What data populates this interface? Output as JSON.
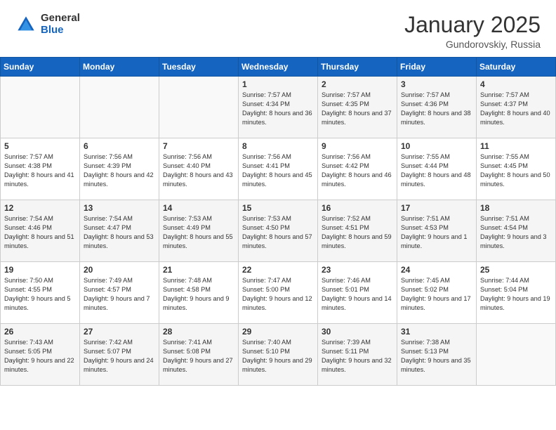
{
  "header": {
    "logo_general": "General",
    "logo_blue": "Blue",
    "month_title": "January 2025",
    "location": "Gundorovskiy, Russia"
  },
  "days_of_week": [
    "Sunday",
    "Monday",
    "Tuesday",
    "Wednesday",
    "Thursday",
    "Friday",
    "Saturday"
  ],
  "weeks": [
    [
      {
        "day": "",
        "info": ""
      },
      {
        "day": "",
        "info": ""
      },
      {
        "day": "",
        "info": ""
      },
      {
        "day": "1",
        "info": "Sunrise: 7:57 AM\nSunset: 4:34 PM\nDaylight: 8 hours and 36 minutes."
      },
      {
        "day": "2",
        "info": "Sunrise: 7:57 AM\nSunset: 4:35 PM\nDaylight: 8 hours and 37 minutes."
      },
      {
        "day": "3",
        "info": "Sunrise: 7:57 AM\nSunset: 4:36 PM\nDaylight: 8 hours and 38 minutes."
      },
      {
        "day": "4",
        "info": "Sunrise: 7:57 AM\nSunset: 4:37 PM\nDaylight: 8 hours and 40 minutes."
      }
    ],
    [
      {
        "day": "5",
        "info": "Sunrise: 7:57 AM\nSunset: 4:38 PM\nDaylight: 8 hours and 41 minutes."
      },
      {
        "day": "6",
        "info": "Sunrise: 7:56 AM\nSunset: 4:39 PM\nDaylight: 8 hours and 42 minutes."
      },
      {
        "day": "7",
        "info": "Sunrise: 7:56 AM\nSunset: 4:40 PM\nDaylight: 8 hours and 43 minutes."
      },
      {
        "day": "8",
        "info": "Sunrise: 7:56 AM\nSunset: 4:41 PM\nDaylight: 8 hours and 45 minutes."
      },
      {
        "day": "9",
        "info": "Sunrise: 7:56 AM\nSunset: 4:42 PM\nDaylight: 8 hours and 46 minutes."
      },
      {
        "day": "10",
        "info": "Sunrise: 7:55 AM\nSunset: 4:44 PM\nDaylight: 8 hours and 48 minutes."
      },
      {
        "day": "11",
        "info": "Sunrise: 7:55 AM\nSunset: 4:45 PM\nDaylight: 8 hours and 50 minutes."
      }
    ],
    [
      {
        "day": "12",
        "info": "Sunrise: 7:54 AM\nSunset: 4:46 PM\nDaylight: 8 hours and 51 minutes."
      },
      {
        "day": "13",
        "info": "Sunrise: 7:54 AM\nSunset: 4:47 PM\nDaylight: 8 hours and 53 minutes."
      },
      {
        "day": "14",
        "info": "Sunrise: 7:53 AM\nSunset: 4:49 PM\nDaylight: 8 hours and 55 minutes."
      },
      {
        "day": "15",
        "info": "Sunrise: 7:53 AM\nSunset: 4:50 PM\nDaylight: 8 hours and 57 minutes."
      },
      {
        "day": "16",
        "info": "Sunrise: 7:52 AM\nSunset: 4:51 PM\nDaylight: 8 hours and 59 minutes."
      },
      {
        "day": "17",
        "info": "Sunrise: 7:51 AM\nSunset: 4:53 PM\nDaylight: 9 hours and 1 minute."
      },
      {
        "day": "18",
        "info": "Sunrise: 7:51 AM\nSunset: 4:54 PM\nDaylight: 9 hours and 3 minutes."
      }
    ],
    [
      {
        "day": "19",
        "info": "Sunrise: 7:50 AM\nSunset: 4:55 PM\nDaylight: 9 hours and 5 minutes."
      },
      {
        "day": "20",
        "info": "Sunrise: 7:49 AM\nSunset: 4:57 PM\nDaylight: 9 hours and 7 minutes."
      },
      {
        "day": "21",
        "info": "Sunrise: 7:48 AM\nSunset: 4:58 PM\nDaylight: 9 hours and 9 minutes."
      },
      {
        "day": "22",
        "info": "Sunrise: 7:47 AM\nSunset: 5:00 PM\nDaylight: 9 hours and 12 minutes."
      },
      {
        "day": "23",
        "info": "Sunrise: 7:46 AM\nSunset: 5:01 PM\nDaylight: 9 hours and 14 minutes."
      },
      {
        "day": "24",
        "info": "Sunrise: 7:45 AM\nSunset: 5:02 PM\nDaylight: 9 hours and 17 minutes."
      },
      {
        "day": "25",
        "info": "Sunrise: 7:44 AM\nSunset: 5:04 PM\nDaylight: 9 hours and 19 minutes."
      }
    ],
    [
      {
        "day": "26",
        "info": "Sunrise: 7:43 AM\nSunset: 5:05 PM\nDaylight: 9 hours and 22 minutes."
      },
      {
        "day": "27",
        "info": "Sunrise: 7:42 AM\nSunset: 5:07 PM\nDaylight: 9 hours and 24 minutes."
      },
      {
        "day": "28",
        "info": "Sunrise: 7:41 AM\nSunset: 5:08 PM\nDaylight: 9 hours and 27 minutes."
      },
      {
        "day": "29",
        "info": "Sunrise: 7:40 AM\nSunset: 5:10 PM\nDaylight: 9 hours and 29 minutes."
      },
      {
        "day": "30",
        "info": "Sunrise: 7:39 AM\nSunset: 5:11 PM\nDaylight: 9 hours and 32 minutes."
      },
      {
        "day": "31",
        "info": "Sunrise: 7:38 AM\nSunset: 5:13 PM\nDaylight: 9 hours and 35 minutes."
      },
      {
        "day": "",
        "info": ""
      }
    ]
  ]
}
